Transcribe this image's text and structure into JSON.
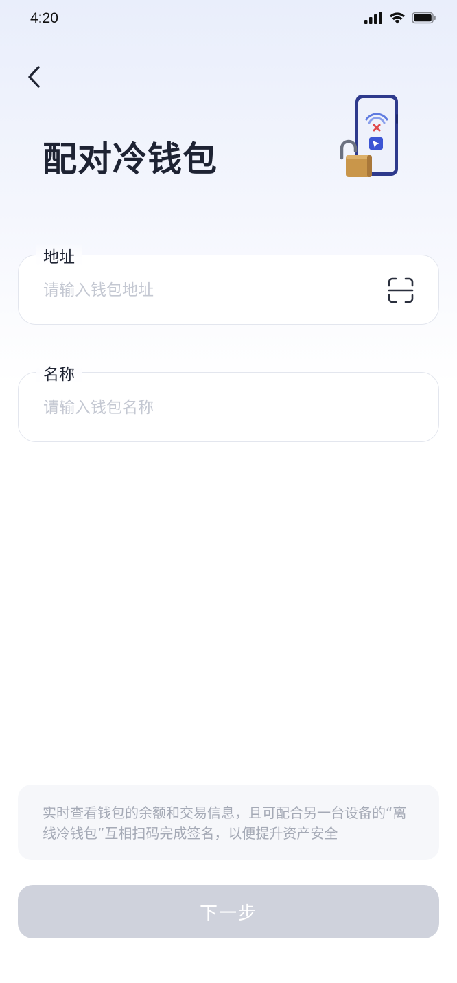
{
  "status_bar": {
    "time": "4:20",
    "icons": [
      "signal-icon",
      "wifi-icon",
      "battery-icon"
    ]
  },
  "header": {
    "back_icon": "chevron-left-icon",
    "title": "配对冷钱包",
    "illustration": "cold-wallet-phone-lock-illustration"
  },
  "form": {
    "address": {
      "label": "地址",
      "placeholder": "请输入钱包地址",
      "value": "",
      "scan_icon": "scan-icon"
    },
    "name": {
      "label": "名称",
      "placeholder": "请输入钱包名称",
      "value": ""
    }
  },
  "info": {
    "text": "实时查看钱包的余额和交易信息，且可配合另一台设备的“离线冷钱包”互相扫码完成签名，以便提升资产安全"
  },
  "footer": {
    "next_label": "下一步"
  },
  "colors": {
    "title": "#1e2333",
    "placeholder": "#c4c8d2",
    "button_disabled": "#cfd2dc",
    "info_bg": "#f6f7fa",
    "info_text": "#a5aab6",
    "phone_frame": "#2e3a8c"
  }
}
